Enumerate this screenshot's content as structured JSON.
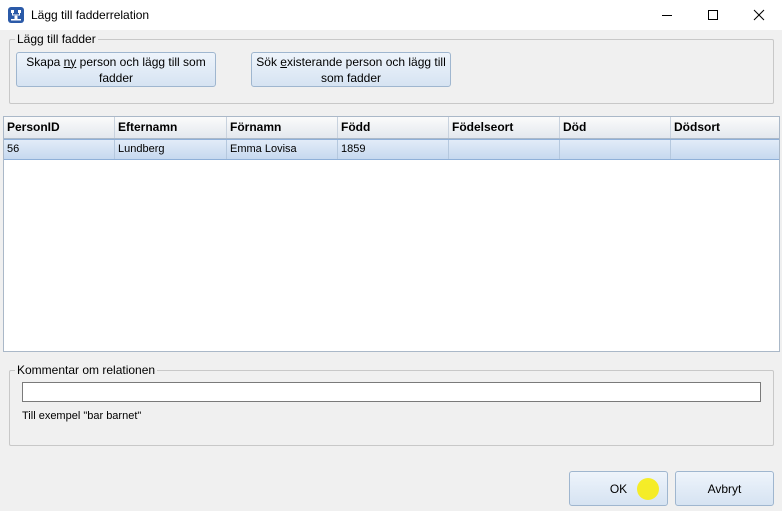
{
  "window": {
    "title": "Lägg till fadderrelation"
  },
  "fadder_group": {
    "legend": "Lägg till fadder",
    "new_person_button": {
      "before": "Skapa ",
      "mnemonic": "ny",
      "after": " person och lägg till som fadder"
    },
    "existing_person_button": {
      "before": "Sök ",
      "mnemonic": "e",
      "after": "xisterande person och lägg till som fadder"
    }
  },
  "grid": {
    "columns": [
      "PersonID",
      "Efternamn",
      "Förnamn",
      "Född",
      "Födelseort",
      "Död",
      "Dödsort"
    ],
    "rows": [
      [
        "56",
        "Lundberg",
        "Emma Lovisa",
        "1859",
        "",
        "",
        ""
      ]
    ]
  },
  "comment_group": {
    "legend": "Kommentar om relationen",
    "value": "",
    "hint": "Till exempel \"bar barnet\""
  },
  "buttons": {
    "ok": "OK",
    "cancel": "Avbryt"
  },
  "colors": {
    "button_border": "#9fb6cf",
    "selected_row": "#c6d9ef",
    "app_icon": "#2b5aa8"
  },
  "icons": {
    "app": "family-tree-icon",
    "minimize": "minimize-icon",
    "maximize": "maximize-icon",
    "close": "close-icon"
  }
}
